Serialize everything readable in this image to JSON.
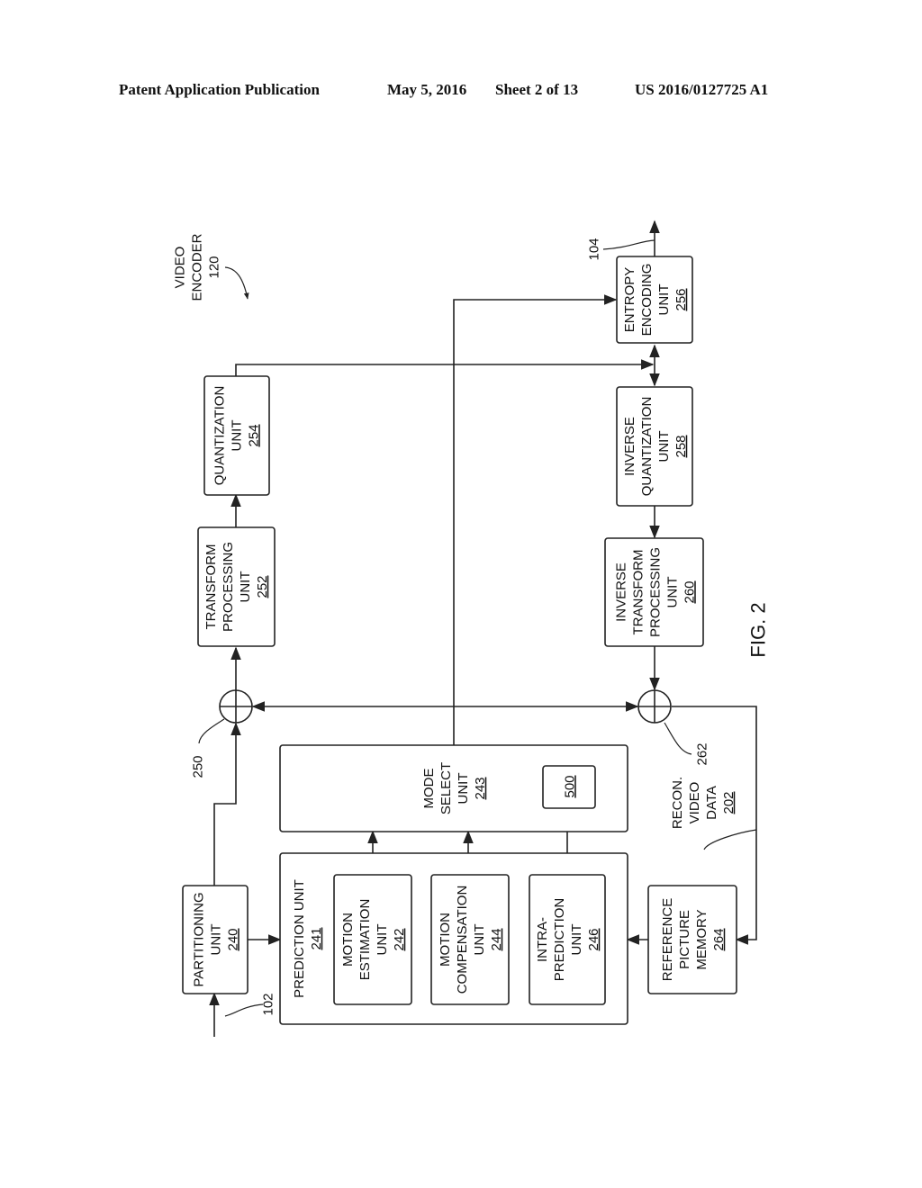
{
  "header": {
    "left": "Patent Application Publication",
    "date": "May 5, 2016",
    "sheet": "Sheet 2 of 13",
    "number": "US 2016/0127725 A1"
  },
  "figure": {
    "caption": "FIG. 2",
    "title": {
      "lines": [
        "VIDEO",
        "ENCODER"
      ],
      "ref": "120"
    },
    "blocks": {
      "partitioning": {
        "lines": [
          "PARTITIONING",
          "UNIT"
        ],
        "ref": "240"
      },
      "prediction": {
        "lines": [
          "PREDICTION UNIT"
        ],
        "ref": "241"
      },
      "motion_estimation": {
        "lines": [
          "MOTION",
          "ESTIMATION",
          "UNIT"
        ],
        "ref": "242"
      },
      "motion_compensation": {
        "lines": [
          "MOTION",
          "COMPENSATION",
          "UNIT"
        ],
        "ref": "244"
      },
      "intra_prediction": {
        "lines": [
          "INTRA-",
          "PREDICTION",
          "UNIT"
        ],
        "ref": "246"
      },
      "mode_select": {
        "lines": [
          "MODE",
          "SELECT",
          "UNIT"
        ],
        "ref": "243"
      },
      "sub_block": {
        "lines": [],
        "ref": "500"
      },
      "transform": {
        "lines": [
          "TRANSFORM",
          "PROCESSING",
          "UNIT"
        ],
        "ref": "252"
      },
      "quantization": {
        "lines": [
          "QUANTIZATION",
          "UNIT"
        ],
        "ref": "254"
      },
      "entropy": {
        "lines": [
          "ENTROPY",
          "ENCODING",
          "UNIT"
        ],
        "ref": "256"
      },
      "inverse_quantization": {
        "lines": [
          "INVERSE",
          "QUANTIZATION",
          "UNIT"
        ],
        "ref": "258"
      },
      "inverse_transform": {
        "lines": [
          "INVERSE",
          "TRANSFORM",
          "PROCESSING",
          "UNIT"
        ],
        "ref": "260"
      },
      "reference_memory": {
        "lines": [
          "REFERENCE",
          "PICTURE",
          "MEMORY"
        ],
        "ref": "264"
      }
    },
    "recon_label": {
      "lines": [
        "RECON.",
        "VIDEO",
        "DATA"
      ],
      "ref": "202"
    },
    "refs": {
      "input": "102",
      "output": "104",
      "summer1": "250",
      "summer2": "262"
    }
  }
}
